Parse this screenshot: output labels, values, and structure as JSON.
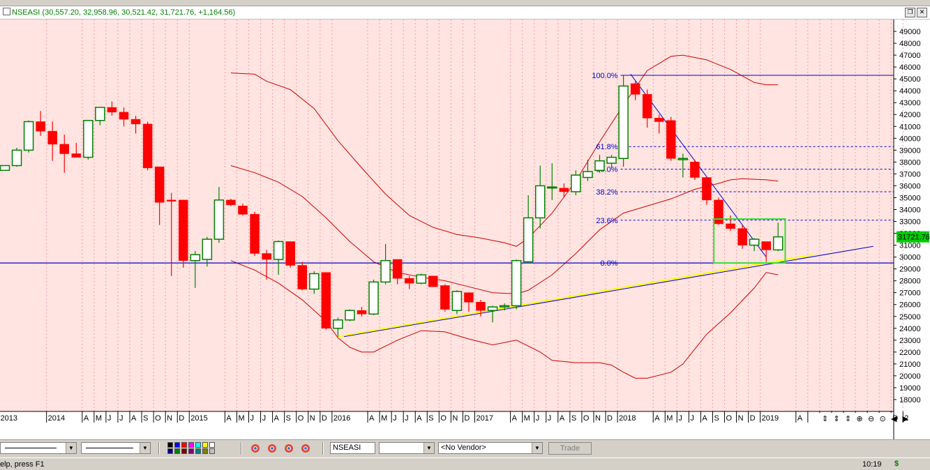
{
  "header": {
    "symbol": "NSEASI",
    "quote": "(30,557.20, 32,958.96, 30,521.42, 31,721.76, +1,164.56)"
  },
  "chart_data": {
    "type": "candlestick",
    "symbol": "NSEASI",
    "interval": "monthly",
    "ylim": [
      17000,
      50000
    ],
    "y_ticks": [
      18000,
      19000,
      20000,
      21000,
      22000,
      23000,
      24000,
      25000,
      26000,
      27000,
      28000,
      29000,
      30000,
      31000,
      32000,
      33000,
      34000,
      35000,
      36000,
      37000,
      38000,
      39000,
      40000,
      41000,
      42000,
      43000,
      44000,
      45000,
      46000,
      47000,
      48000,
      49000
    ],
    "last_price_label": "31721.76",
    "x_labels": [
      {
        "i": 0,
        "t": "2013"
      },
      {
        "i": 4,
        "t": "2014"
      },
      {
        "i": 7,
        "t": "A"
      },
      {
        "i": 8,
        "t": "M"
      },
      {
        "i": 9,
        "t": "J"
      },
      {
        "i": 10,
        "t": "J"
      },
      {
        "i": 11,
        "t": "A"
      },
      {
        "i": 12,
        "t": "S"
      },
      {
        "i": 13,
        "t": "O"
      },
      {
        "i": 14,
        "t": "N"
      },
      {
        "i": 15,
        "t": "D"
      },
      {
        "i": 16,
        "t": "2015"
      },
      {
        "i": 19,
        "t": "A"
      },
      {
        "i": 20,
        "t": "M"
      },
      {
        "i": 21,
        "t": "J"
      },
      {
        "i": 22,
        "t": "J"
      },
      {
        "i": 23,
        "t": "A"
      },
      {
        "i": 24,
        "t": "S"
      },
      {
        "i": 25,
        "t": "O"
      },
      {
        "i": 26,
        "t": "N"
      },
      {
        "i": 27,
        "t": "D"
      },
      {
        "i": 28,
        "t": "2016"
      },
      {
        "i": 31,
        "t": "A"
      },
      {
        "i": 32,
        "t": "M"
      },
      {
        "i": 33,
        "t": "J"
      },
      {
        "i": 34,
        "t": "J"
      },
      {
        "i": 35,
        "t": "A"
      },
      {
        "i": 36,
        "t": "S"
      },
      {
        "i": 37,
        "t": "O"
      },
      {
        "i": 38,
        "t": "N"
      },
      {
        "i": 39,
        "t": "D"
      },
      {
        "i": 40,
        "t": "2017"
      },
      {
        "i": 43,
        "t": "A"
      },
      {
        "i": 44,
        "t": "M"
      },
      {
        "i": 45,
        "t": "J"
      },
      {
        "i": 46,
        "t": "J"
      },
      {
        "i": 47,
        "t": "A"
      },
      {
        "i": 48,
        "t": "S"
      },
      {
        "i": 49,
        "t": "O"
      },
      {
        "i": 50,
        "t": "N"
      },
      {
        "i": 51,
        "t": "D"
      },
      {
        "i": 52,
        "t": "2018"
      },
      {
        "i": 55,
        "t": "A"
      },
      {
        "i": 56,
        "t": "M"
      },
      {
        "i": 57,
        "t": "J"
      },
      {
        "i": 58,
        "t": "J"
      },
      {
        "i": 59,
        "t": "A"
      },
      {
        "i": 60,
        "t": "S"
      },
      {
        "i": 61,
        "t": "O"
      },
      {
        "i": 62,
        "t": "N"
      },
      {
        "i": 63,
        "t": "D"
      },
      {
        "i": 64,
        "t": "2019"
      },
      {
        "i": 67,
        "t": "A"
      },
      {
        "i": 68,
        "t": "M"
      },
      {
        "i": 69,
        "t": "J"
      },
      {
        "i": 70,
        "t": "J"
      },
      {
        "i": 71,
        "t": "A"
      },
      {
        "i": 72,
        "t": "S"
      },
      {
        "i": 73,
        "t": "O"
      },
      {
        "i": 74,
        "t": "N"
      },
      {
        "i": 75,
        "t": "D"
      },
      {
        "i": 76,
        "t": "2"
      }
    ],
    "candles": [
      {
        "i": 0,
        "o": 37300,
        "h": 37700,
        "l": 37300,
        "c": 37700
      },
      {
        "i": 1,
        "o": 37700,
        "h": 39200,
        "l": 37600,
        "c": 39000
      },
      {
        "i": 2,
        "o": 39000,
        "h": 41500,
        "l": 38800,
        "c": 41400
      },
      {
        "i": 3,
        "o": 41400,
        "h": 42300,
        "l": 40200,
        "c": 40600
      },
      {
        "i": 4,
        "o": 40600,
        "h": 41400,
        "l": 38100,
        "c": 39500
      },
      {
        "i": 5,
        "o": 39500,
        "h": 40300,
        "l": 37100,
        "c": 38700
      },
      {
        "i": 6,
        "o": 38700,
        "h": 39600,
        "l": 38400,
        "c": 38400
      },
      {
        "i": 7,
        "o": 38400,
        "h": 41500,
        "l": 38200,
        "c": 41500
      },
      {
        "i": 8,
        "o": 41500,
        "h": 42600,
        "l": 41100,
        "c": 42600
      },
      {
        "i": 9,
        "o": 42600,
        "h": 43100,
        "l": 41900,
        "c": 42200
      },
      {
        "i": 10,
        "o": 42200,
        "h": 42600,
        "l": 41000,
        "c": 41600
      },
      {
        "i": 11,
        "o": 41600,
        "h": 41900,
        "l": 40400,
        "c": 41200
      },
      {
        "i": 12,
        "o": 41200,
        "h": 41400,
        "l": 37300,
        "c": 37500
      },
      {
        "i": 13,
        "o": 37600,
        "h": 37600,
        "l": 32700,
        "c": 34600
      },
      {
        "i": 14,
        "o": 34800,
        "h": 35400,
        "l": 28400,
        "c": 34700
      },
      {
        "i": 15,
        "o": 34800,
        "h": 34800,
        "l": 29100,
        "c": 29700
      },
      {
        "i": 16,
        "o": 29700,
        "h": 30500,
        "l": 27400,
        "c": 30200
      },
      {
        "i": 17,
        "o": 29800,
        "h": 31700,
        "l": 29200,
        "c": 31500
      },
      {
        "i": 18,
        "o": 31500,
        "h": 35900,
        "l": 31200,
        "c": 34800
      },
      {
        "i": 19,
        "o": 34800,
        "h": 34900,
        "l": 34300,
        "c": 34400
      },
      {
        "i": 20,
        "o": 34300,
        "h": 34500,
        "l": 33500,
        "c": 33600
      },
      {
        "i": 21,
        "o": 33600,
        "h": 33800,
        "l": 30100,
        "c": 30300
      },
      {
        "i": 22,
        "o": 30300,
        "h": 30600,
        "l": 28100,
        "c": 29800
      },
      {
        "i": 23,
        "o": 29800,
        "h": 31400,
        "l": 28500,
        "c": 31300
      },
      {
        "i": 24,
        "o": 31300,
        "h": 31300,
        "l": 29100,
        "c": 29300
      },
      {
        "i": 25,
        "o": 29300,
        "h": 29600,
        "l": 27200,
        "c": 27300
      },
      {
        "i": 26,
        "o": 27300,
        "h": 28800,
        "l": 26900,
        "c": 28600
      },
      {
        "i": 27,
        "o": 28700,
        "h": 28700,
        "l": 23900,
        "c": 24000
      },
      {
        "i": 28,
        "o": 24000,
        "h": 24900,
        "l": 23300,
        "c": 24700
      },
      {
        "i": 29,
        "o": 24700,
        "h": 25600,
        "l": 24600,
        "c": 25500
      },
      {
        "i": 30,
        "o": 25500,
        "h": 25800,
        "l": 25000,
        "c": 25200
      },
      {
        "i": 31,
        "o": 25200,
        "h": 28100,
        "l": 25100,
        "c": 27900
      },
      {
        "i": 32,
        "o": 27900,
        "h": 31100,
        "l": 27700,
        "c": 29700
      },
      {
        "i": 33,
        "o": 29800,
        "h": 29800,
        "l": 27700,
        "c": 28200
      },
      {
        "i": 34,
        "o": 28200,
        "h": 28400,
        "l": 27300,
        "c": 27800
      },
      {
        "i": 35,
        "o": 27800,
        "h": 28600,
        "l": 27700,
        "c": 28500
      },
      {
        "i": 36,
        "o": 28400,
        "h": 28400,
        "l": 27500,
        "c": 27500
      },
      {
        "i": 37,
        "o": 27600,
        "h": 27700,
        "l": 25400,
        "c": 25600
      },
      {
        "i": 38,
        "o": 25500,
        "h": 27200,
        "l": 25200,
        "c": 27100
      },
      {
        "i": 39,
        "o": 27000,
        "h": 27000,
        "l": 25400,
        "c": 26200
      },
      {
        "i": 40,
        "o": 26200,
        "h": 26400,
        "l": 25000,
        "c": 25500
      },
      {
        "i": 41,
        "o": 25500,
        "h": 25900,
        "l": 24500,
        "c": 25800
      },
      {
        "i": 42,
        "o": 25800,
        "h": 26100,
        "l": 25500,
        "c": 25900
      },
      {
        "i": 43,
        "o": 25900,
        "h": 29800,
        "l": 25600,
        "c": 29700
      },
      {
        "i": 44,
        "o": 29600,
        "h": 35200,
        "l": 29500,
        "c": 33300
      },
      {
        "i": 45,
        "o": 33300,
        "h": 37700,
        "l": 32400,
        "c": 36000
      },
      {
        "i": 46,
        "o": 35900,
        "h": 37900,
        "l": 34800,
        "c": 35900
      },
      {
        "i": 47,
        "o": 35800,
        "h": 36200,
        "l": 35000,
        "c": 35500
      },
      {
        "i": 48,
        "o": 35500,
        "h": 37300,
        "l": 35200,
        "c": 36900
      },
      {
        "i": 49,
        "o": 36700,
        "h": 38200,
        "l": 36400,
        "c": 37200
      },
      {
        "i": 50,
        "o": 37300,
        "h": 38600,
        "l": 37100,
        "c": 38100
      },
      {
        "i": 51,
        "o": 37900,
        "h": 38600,
        "l": 37400,
        "c": 38400
      },
      {
        "i": 52,
        "o": 38300,
        "h": 45300,
        "l": 37600,
        "c": 44400
      },
      {
        "i": 53,
        "o": 44600,
        "h": 44800,
        "l": 43200,
        "c": 43700
      },
      {
        "i": 54,
        "o": 43700,
        "h": 44100,
        "l": 40900,
        "c": 41700
      },
      {
        "i": 55,
        "o": 41700,
        "h": 42000,
        "l": 40400,
        "c": 41400
      },
      {
        "i": 56,
        "o": 41500,
        "h": 41800,
        "l": 38100,
        "c": 38300
      },
      {
        "i": 57,
        "o": 38200,
        "h": 38700,
        "l": 36700,
        "c": 38300
      },
      {
        "i": 58,
        "o": 38000,
        "h": 38200,
        "l": 36500,
        "c": 36700
      },
      {
        "i": 59,
        "o": 36700,
        "h": 36800,
        "l": 34400,
        "c": 34800
      },
      {
        "i": 60,
        "o": 34800,
        "h": 35000,
        "l": 32700,
        "c": 32800
      },
      {
        "i": 61,
        "o": 32800,
        "h": 33500,
        "l": 32200,
        "c": 32400
      },
      {
        "i": 62,
        "o": 32400,
        "h": 32700,
        "l": 30700,
        "c": 31000
      },
      {
        "i": 63,
        "o": 31000,
        "h": 31600,
        "l": 30500,
        "c": 31500
      },
      {
        "i": 64,
        "o": 31300,
        "h": 31300,
        "l": 29600,
        "c": 30600
      },
      {
        "i": 65,
        "o": 30600,
        "h": 32900,
        "l": 30500,
        "c": 31700
      }
    ],
    "bollinger": {
      "upper": [
        [
          19,
          45500
        ],
        [
          21,
          45400
        ],
        [
          22,
          44800
        ],
        [
          24,
          44100
        ],
        [
          26,
          42500
        ],
        [
          28,
          39800
        ],
        [
          30,
          37500
        ],
        [
          32,
          35300
        ],
        [
          34,
          33500
        ],
        [
          36,
          32500
        ],
        [
          38,
          31900
        ],
        [
          40,
          31600
        ],
        [
          42,
          31200
        ],
        [
          43,
          30900
        ],
        [
          44,
          31600
        ],
        [
          46,
          33700
        ],
        [
          48,
          36400
        ],
        [
          50,
          39700
        ],
        [
          52,
          42800
        ],
        [
          54,
          45700
        ],
        [
          56,
          46900
        ],
        [
          57,
          47000
        ],
        [
          59,
          46600
        ],
        [
          61,
          45800
        ],
        [
          63,
          44700
        ],
        [
          64,
          44500
        ],
        [
          65,
          44500
        ]
      ],
      "middle": [
        [
          19,
          37700
        ],
        [
          21,
          37100
        ],
        [
          23,
          36300
        ],
        [
          25,
          35100
        ],
        [
          27,
          33300
        ],
        [
          29,
          31300
        ],
        [
          31,
          29600
        ],
        [
          33,
          28700
        ],
        [
          35,
          28300
        ],
        [
          37,
          28000
        ],
        [
          39,
          27500
        ],
        [
          41,
          27000
        ],
        [
          43,
          26900
        ],
        [
          44,
          27200
        ],
        [
          46,
          28500
        ],
        [
          48,
          30300
        ],
        [
          50,
          32300
        ],
        [
          52,
          33700
        ],
        [
          54,
          34300
        ],
        [
          56,
          34900
        ],
        [
          58,
          35700
        ],
        [
          60,
          36200
        ],
        [
          61,
          36500
        ],
        [
          62,
          36600
        ],
        [
          64,
          36500
        ],
        [
          65,
          36400
        ]
      ],
      "lower": [
        [
          19,
          29700
        ],
        [
          21,
          28900
        ],
        [
          23,
          27800
        ],
        [
          25,
          26400
        ],
        [
          27,
          24600
        ],
        [
          28,
          23200
        ],
        [
          29,
          22400
        ],
        [
          30,
          22000
        ],
        [
          31,
          22000
        ],
        [
          33,
          23000
        ],
        [
          35,
          23800
        ],
        [
          37,
          23700
        ],
        [
          39,
          23100
        ],
        [
          41,
          22600
        ],
        [
          43,
          23000
        ],
        [
          45,
          22000
        ],
        [
          46,
          21300
        ],
        [
          48,
          21100
        ],
        [
          50,
          21100
        ],
        [
          51,
          20900
        ],
        [
          52,
          20300
        ],
        [
          53,
          19800
        ],
        [
          54,
          19800
        ],
        [
          56,
          20300
        ],
        [
          57,
          21000
        ],
        [
          59,
          23500
        ],
        [
          61,
          25300
        ],
        [
          63,
          27400
        ],
        [
          64,
          28700
        ],
        [
          65,
          28500
        ]
      ]
    },
    "fibonacci": {
      "from_i": 52,
      "to_i": 72,
      "levels": [
        {
          "label": "100.0%",
          "value": 45300
        },
        {
          "label": "61.8%",
          "value": 39300
        },
        {
          "label": "50.0%",
          "value": 37400
        },
        {
          "label": "38.2%",
          "value": 35500
        },
        {
          "label": "23.6%",
          "value": 33100
        },
        {
          "label": "0.0%",
          "value": 29500
        }
      ]
    },
    "horizontal_line": {
      "value": 29500
    },
    "trendlines": [
      {
        "color": "#0000cc",
        "from": {
          "i": 28.5,
          "v": 23300
        },
        "to": {
          "i": 73,
          "v": 30900
        }
      },
      {
        "color": "#ffff00",
        "from": {
          "i": 28,
          "v": 23300
        },
        "to": {
          "i": 68,
          "v": 30200
        }
      },
      {
        "color": "#0000cc",
        "from": {
          "i": 52.6,
          "v": 45400
        },
        "to": {
          "i": 64,
          "v": 30000
        }
      }
    ],
    "highlight_box": {
      "from_i": 59.6,
      "to_i": 65.6,
      "top": 33200,
      "bottom": 29500
    }
  },
  "toolbar": {
    "symbol_field": "NSEASI",
    "vendor_select": "<No Vendor>",
    "trade_label": "Trade",
    "palette": [
      "#000000",
      "#0000ff",
      "#ff0000",
      "#ff00ff",
      "#00ffff",
      "#ffff00",
      "#ffffff",
      "#000080",
      "#008000",
      "#800000",
      "#800080",
      "#008080",
      "#808000",
      "#c0c0c0"
    ]
  },
  "status": {
    "help": "elp, press F1",
    "clock": "10:19",
    "currency": "$"
  },
  "colors": {
    "background": "#ffe4e1",
    "up_body": "#ffffff",
    "up_border": "#008000",
    "down_body": "#ff0000",
    "bands": "#cc0000",
    "fib": "#0000cc",
    "box": "#33dd33"
  }
}
